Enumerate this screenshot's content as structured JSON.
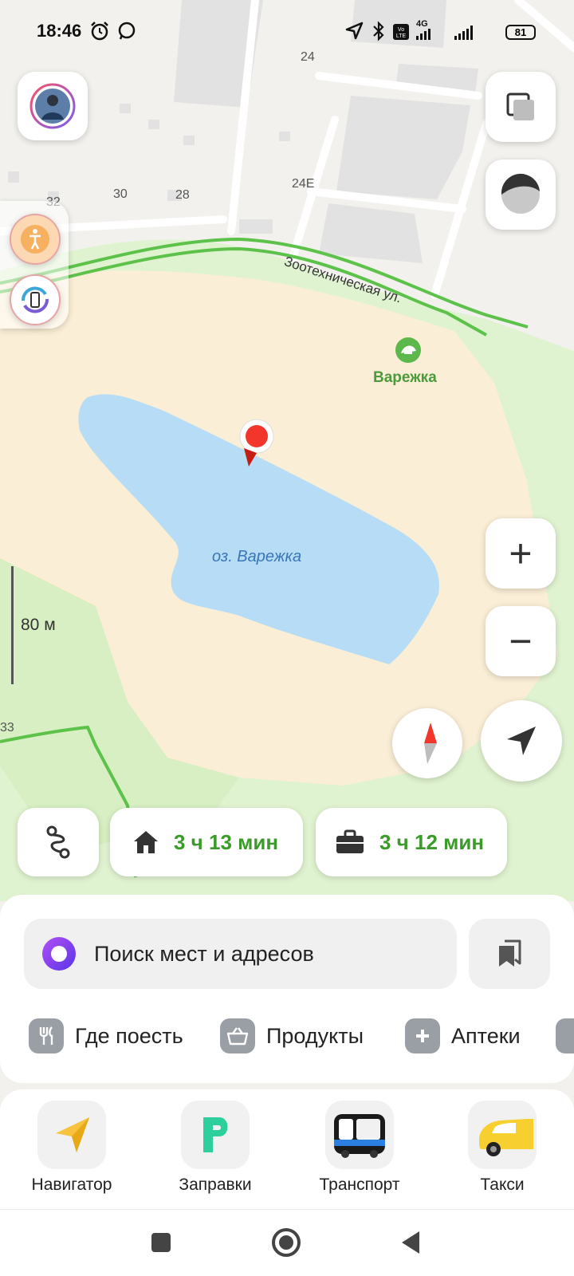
{
  "status_bar": {
    "time": "18:46",
    "network": "4G",
    "battery": "81"
  },
  "map": {
    "house_numbers": [
      "24",
      "24Е",
      "32",
      "30",
      "28",
      "33"
    ],
    "street_name": "Зоотехническая ул.",
    "poi_name": "Варежка",
    "lake_name": "оз. Варежка",
    "scale": "80 м",
    "colors": {
      "park": "#e0f3d0",
      "sand": "#faeed6",
      "water": "#b6ddf5",
      "road_green": "#5cc24a",
      "pin": "#f2362c"
    }
  },
  "controls": {
    "zoom_in": "+",
    "zoom_out": "−",
    "icons": [
      "profile-avatar-icon",
      "layers-icon",
      "map-mode-icon",
      "pedestrian-icon",
      "refresh-icon",
      "compass-icon",
      "my-location-icon",
      "route-icon"
    ]
  },
  "chips": {
    "home_time": "3 ч 13 мин",
    "work_time": "3 ч 12 мин"
  },
  "search": {
    "placeholder": "Поиск мест и адресов"
  },
  "categories": [
    {
      "label": "Где поесть",
      "icon": "fork-knife-icon"
    },
    {
      "label": "Продукты",
      "icon": "basket-icon"
    },
    {
      "label": "Аптеки",
      "icon": "plus-icon"
    }
  ],
  "services": [
    {
      "label": "Навигатор",
      "icon": "navigator-arrow-icon"
    },
    {
      "label": "Заправки",
      "icon": "fuel-p-icon"
    },
    {
      "label": "Транспорт",
      "icon": "bus-icon"
    },
    {
      "label": "Такси",
      "icon": "taxi-car-icon"
    }
  ]
}
